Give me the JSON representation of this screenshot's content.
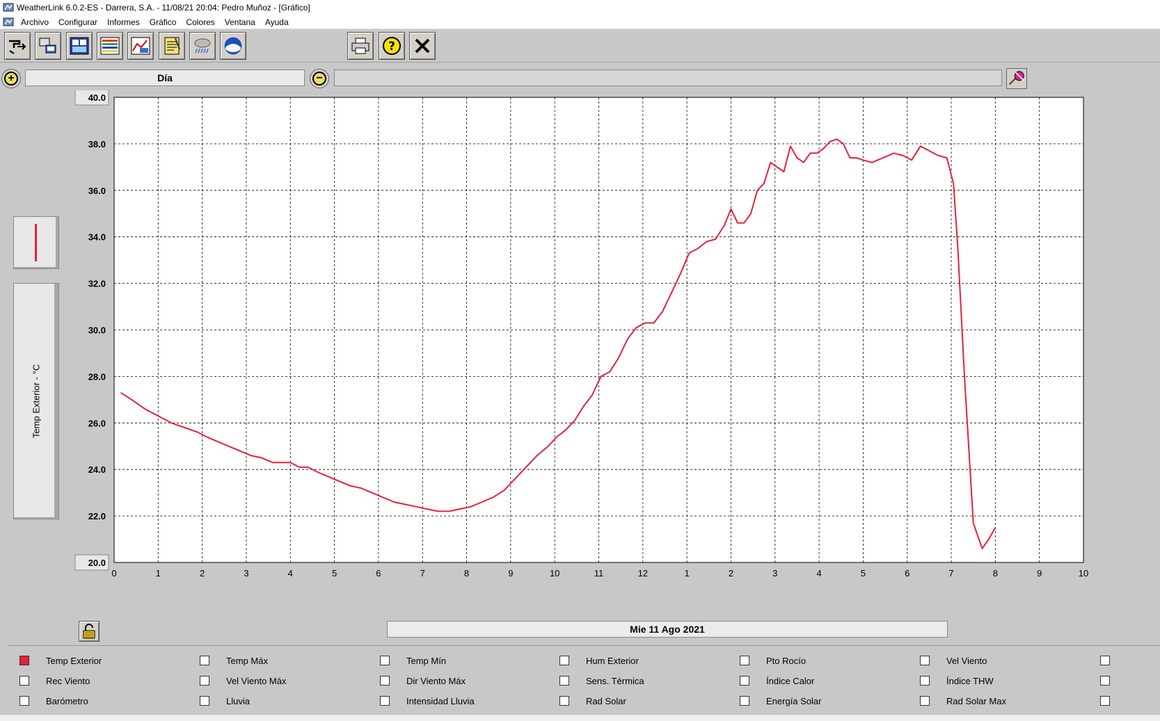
{
  "window": {
    "title": "WeatherLink 6.0.2-ES  -  Darrera, S.A.  -  11/08/21  20:04: Pedro Muñoz - [Gráfico]"
  },
  "menu": [
    "Archivo",
    "Configurar",
    "Informes",
    "Gráfico",
    "Colores",
    "Ventana",
    "Ayuda"
  ],
  "toolbar": {
    "buttons": [
      "console-icon",
      "data-transfer-icon",
      "bulletin-icon",
      "strip-chart-icon",
      "graph-icon",
      "notes-icon",
      "rain-icon",
      "noaa-icon"
    ],
    "right_buttons": [
      "print-icon",
      "help-icon",
      "close-icon"
    ]
  },
  "zoom": {
    "period": "Día"
  },
  "chart": {
    "y_axis_label": "Temp Exterior - °C",
    "date_label": "Mie 11 Ago 2021",
    "line_color": "#e8203a"
  },
  "chart_data": {
    "type": "line",
    "title": "",
    "ylabel": "Temp Exterior - °C",
    "xlabel": "Mie 11 Ago 2021",
    "ylim": [
      20.0,
      40.0
    ],
    "yticks": [
      "20.0",
      "22.0",
      "24.0",
      "26.0",
      "28.0",
      "30.0",
      "32.0",
      "34.0",
      "36.0",
      "38.0",
      "40.0"
    ],
    "xlim": [
      0,
      22
    ],
    "xtick_labels": [
      "0",
      "1",
      "2",
      "3",
      "4",
      "5",
      "6",
      "7",
      "8",
      "9",
      "10",
      "11",
      "12",
      "1",
      "2",
      "3",
      "4",
      "5",
      "6",
      "7",
      "8",
      "9",
      "10"
    ],
    "grid": true,
    "series": [
      {
        "color": "#e8203a",
        "x": [
          0.15,
          0.4,
          0.7,
          1.0,
          1.3,
          1.6,
          1.9,
          2.1,
          2.35,
          2.6,
          2.85,
          3.1,
          3.35,
          3.6,
          3.85,
          4.0,
          4.2,
          4.4,
          4.6,
          4.85,
          5.1,
          5.35,
          5.6,
          5.85,
          6.1,
          6.35,
          6.6,
          6.85,
          7.1,
          7.35,
          7.6,
          7.85,
          8.1,
          8.35,
          8.6,
          8.85,
          9.1,
          9.35,
          9.6,
          9.85,
          10.05,
          10.25,
          10.45,
          10.65,
          10.85,
          11.05,
          11.25,
          11.45,
          11.65,
          11.85,
          12.05,
          12.25,
          12.45,
          12.65,
          12.85,
          13.05,
          13.25,
          13.45,
          13.65,
          13.85,
          14.0,
          14.15,
          14.3,
          14.45,
          14.6,
          14.75,
          14.9,
          15.05,
          15.2,
          15.35,
          15.5,
          15.65,
          15.8,
          15.95,
          16.1,
          16.25,
          16.4,
          16.55,
          16.7,
          16.85,
          17.0,
          17.2,
          17.45,
          17.7,
          17.9,
          18.1,
          18.3,
          18.5,
          18.7,
          18.9,
          19.05,
          19.15,
          19.3,
          19.5,
          19.7,
          19.85,
          20.0
        ],
        "values": [
          27.3,
          27.0,
          26.6,
          26.3,
          26.0,
          25.8,
          25.6,
          25.4,
          25.2,
          25.0,
          24.8,
          24.6,
          24.5,
          24.3,
          24.3,
          24.3,
          24.1,
          24.1,
          23.9,
          23.7,
          23.5,
          23.3,
          23.2,
          23.0,
          22.8,
          22.6,
          22.5,
          22.4,
          22.3,
          22.2,
          22.2,
          22.3,
          22.4,
          22.6,
          22.8,
          23.1,
          23.6,
          24.1,
          24.6,
          25.0,
          25.4,
          25.7,
          26.1,
          26.7,
          27.2,
          28.0,
          28.2,
          28.8,
          29.6,
          30.1,
          30.3,
          30.3,
          30.8,
          31.6,
          32.4,
          33.3,
          33.5,
          33.8,
          33.9,
          34.5,
          35.2,
          34.6,
          34.6,
          35.0,
          36.0,
          36.3,
          37.2,
          37.0,
          36.8,
          37.9,
          37.4,
          37.2,
          37.6,
          37.6,
          37.8,
          38.1,
          38.2,
          38.0,
          37.4,
          37.4,
          37.3,
          37.2,
          37.4,
          37.6,
          37.5,
          37.3,
          37.9,
          37.7,
          37.5,
          37.4,
          36.3,
          33.5,
          28.0,
          21.7,
          20.6,
          21.0,
          21.5
        ]
      }
    ]
  },
  "channels": [
    [
      {
        "label": "Temp Exterior",
        "checked": true
      },
      {
        "label": "Rec Viento",
        "checked": false
      },
      {
        "label": "Barómetro",
        "checked": false
      }
    ],
    [
      {
        "label": "Temp Máx",
        "checked": false
      },
      {
        "label": "Vel Viento Máx",
        "checked": false
      },
      {
        "label": "Lluvia",
        "checked": false
      }
    ],
    [
      {
        "label": "Temp Mín",
        "checked": false
      },
      {
        "label": "Dir Viento Máx",
        "checked": false
      },
      {
        "label": "Intensidad Lluvia",
        "checked": false
      }
    ],
    [
      {
        "label": "Hum Exterior",
        "checked": false
      },
      {
        "label": "Sens. Térmica",
        "checked": false
      },
      {
        "label": "Rad Solar",
        "checked": false
      }
    ],
    [
      {
        "label": "Pto Rocío",
        "checked": false
      },
      {
        "label": "Índice Calor",
        "checked": false
      },
      {
        "label": "Energía Solar",
        "checked": false
      }
    ],
    [
      {
        "label": "Vel Viento",
        "checked": false
      },
      {
        "label": "Índice THW",
        "checked": false
      },
      {
        "label": "Rad Solar Max",
        "checked": false
      }
    ],
    [
      {
        "label": "",
        "checked": false
      },
      {
        "label": "",
        "checked": false
      },
      {
        "label": "",
        "checked": false
      }
    ]
  ]
}
